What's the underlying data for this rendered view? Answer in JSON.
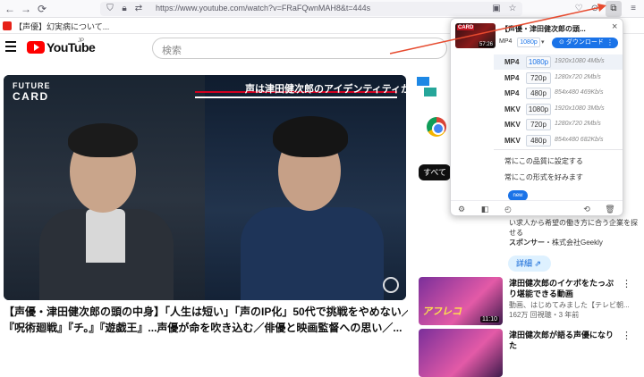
{
  "browser": {
    "url": "https://www.youtube.com/watch?v=FRaFQwnMAH8&t=444s",
    "bookmark_label": "【声優】幻実病について..."
  },
  "youtube": {
    "logo_text": "YouTube",
    "region": "JP",
    "search_placeholder": "検索"
  },
  "video": {
    "brand_line1": "FUTURE",
    "brand_line2": "CARD",
    "caption": "声は津田健次郎のアイデンティティか？",
    "title_line1": "【声優・津田健次郎の頭の中身】「人生は短い」「声のIP化」50代で挑戦をやめない／",
    "title_line2": "『呪術廻戦』『チ。』『遊戯王』...声優が命を吹き込む／俳優と映画監督への思い／..."
  },
  "sidebar": {
    "chip_all": "すべて",
    "ad_desc": "い求人から希望の働き方に合う企業を探せる",
    "ad_sponsor_label": "スポンサー",
    "ad_sponsor_name": "・株式会社Geekly",
    "details_label": "詳細",
    "related": [
      {
        "title": "津田健次郎のイケボをたっぷり堪能できる動画",
        "meta1": "動画、はじめてみました【テレビ朝...",
        "meta2": "162万 回視聴・3 年前",
        "duration": "11:10",
        "thumb_text": "アフレコ"
      },
      {
        "title": "津田健次郎が語る声優になりた",
        "meta1": "",
        "meta2": "",
        "duration": "",
        "thumb_text": ""
      }
    ]
  },
  "popup": {
    "title": "【声優・津田健次郎の頭...",
    "thumb_duration": "57:26",
    "thumb_tag": "CARD",
    "selected_format": "MP4",
    "selected_res": "1080p",
    "download_label": "ダウンロード",
    "qualities": [
      {
        "format": "MP4",
        "res": "1080p",
        "info": "1920x1080 4Mb/s",
        "selected": true
      },
      {
        "format": "MP4",
        "res": "720p",
        "info": "1280x720 2Mb/s",
        "selected": false
      },
      {
        "format": "MP4",
        "res": "480p",
        "info": "854x480 469Kb/s",
        "selected": false
      },
      {
        "format": "MKV",
        "res": "1080p",
        "info": "1920x1080 3Mb/s",
        "selected": false
      },
      {
        "format": "MKV",
        "res": "720p",
        "info": "1280x720 2Mb/s",
        "selected": false
      },
      {
        "format": "MKV",
        "res": "480p",
        "info": "854x480 682Kb/s",
        "selected": false
      }
    ],
    "option_quality": "常にこの品質に設定する",
    "option_format": "常にこの形式を好みます",
    "new_badge": "new",
    "accent": "#1a73e8"
  },
  "colors": {
    "annotation_arrow": "#e64a2e",
    "youtube_red": "#ff0000"
  }
}
